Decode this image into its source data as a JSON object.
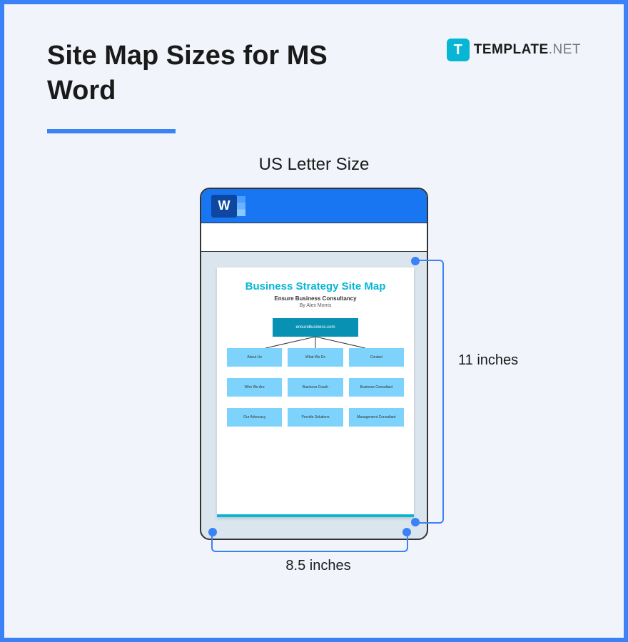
{
  "header": {
    "title": "Site Map Sizes for MS Word",
    "brand_letter": "T",
    "brand_text": "TEMPLATE",
    "brand_suffix": ".NET"
  },
  "size_label": "US Letter Size",
  "word_icon_letter": "W",
  "dimensions": {
    "width_label": "8.5 inches",
    "height_label": "11 inches"
  },
  "document": {
    "title": "Business Strategy Site Map",
    "subtitle1": "Ensure Business Consultancy",
    "subtitle2": "By Alex Morris",
    "root": "ensurebusiness.com",
    "rows": [
      [
        "About Us",
        "What We Do",
        "Contact"
      ],
      [
        "Who We Are",
        "Business Coach",
        "Business Consultant"
      ],
      [
        "Our Advocacy",
        "Provide Solutions",
        "Management Consultant"
      ]
    ]
  }
}
